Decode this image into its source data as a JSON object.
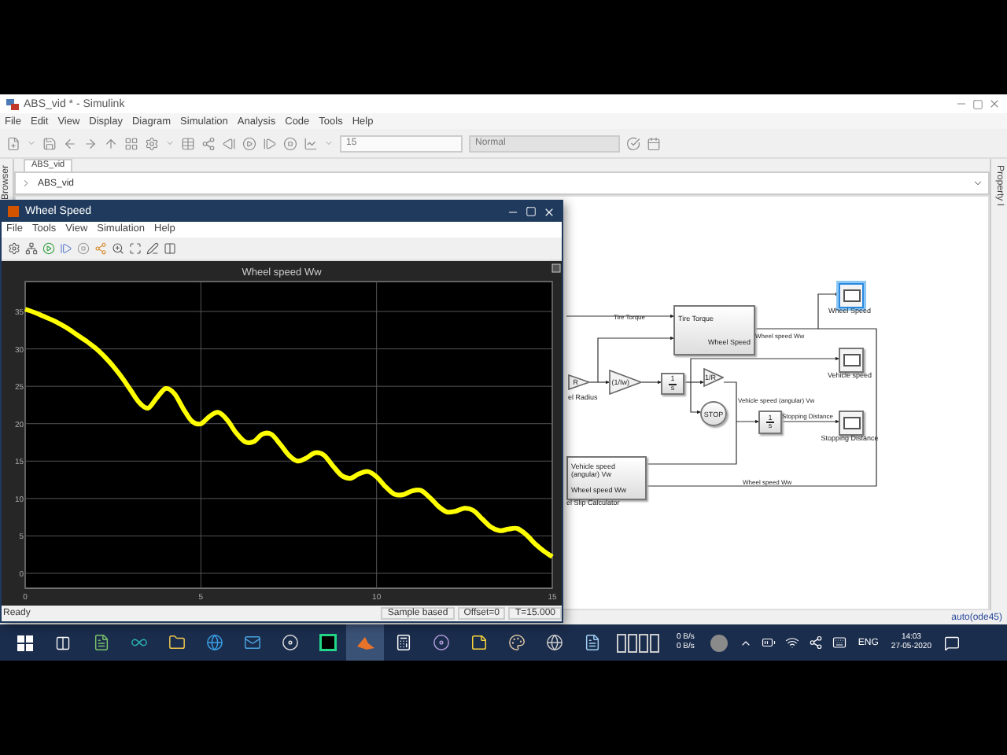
{
  "simulink_window": {
    "title": "ABS_vid * - Simulink",
    "menu": [
      "File",
      "Edit",
      "View",
      "Display",
      "Diagram",
      "Simulation",
      "Analysis",
      "Code",
      "Tools",
      "Help"
    ],
    "stop_time": "15",
    "sim_mode": "Normal",
    "tab": {
      "label": "ABS_vid",
      "selected": true
    },
    "breadcrumb": "ABS_vid",
    "left_panel": "Browser",
    "right_panel": "Property I",
    "status_right": "auto(ode45)"
  },
  "diagram": {
    "blocks": [
      {
        "kind": "scope",
        "label": "Wheel Speed",
        "selected": true
      },
      {
        "kind": "subsystem",
        "ports_in": [
          "Tire Torque"
        ],
        "ports_out": [
          "Wheel Speed"
        ]
      },
      {
        "kind": "scope",
        "label": "Vehicle speed",
        "selected": false
      },
      {
        "kind": "gain",
        "text": "R",
        "label": "el Radius"
      },
      {
        "kind": "gain",
        "text": "(1/Iw)"
      },
      {
        "kind": "integrator",
        "numerator": "1",
        "denominator": "s"
      },
      {
        "kind": "gain",
        "text": "1/R"
      },
      {
        "kind": "stop",
        "text": "STOP"
      },
      {
        "kind": "integrator",
        "numerator": "1",
        "denominator": "s"
      },
      {
        "kind": "scope",
        "label": "Stopping Distance",
        "selected": false
      },
      {
        "kind": "subsystem",
        "ports_in": [
          "Vehicle speed (angular) Vw",
          "Wheel speed Ww"
        ],
        "label": "el Slip Calculator"
      }
    ],
    "signal_labels": [
      "Tire Torque",
      "Wheel speed Ww",
      "Vehicle speed (angular) Vw",
      "Stopping Distance",
      "Wheel speed Ww"
    ]
  },
  "scope_window": {
    "title": "Wheel Speed",
    "menu": [
      "File",
      "Tools",
      "View",
      "Simulation",
      "Help"
    ],
    "chart_data": {
      "type": "line",
      "title": "Wheel speed Ww",
      "grid": true,
      "xlim": [
        0,
        15
      ],
      "ylim": [
        -2,
        39
      ],
      "xticks": [
        0,
        5,
        10,
        15
      ],
      "yticks": [
        0,
        5,
        10,
        15,
        20,
        25,
        30,
        35
      ],
      "x": [
        0,
        0.25,
        0.5,
        0.75,
        1,
        1.25,
        1.5,
        1.75,
        2,
        2.25,
        2.5,
        2.75,
        3,
        3.25,
        3.5,
        3.75,
        4,
        4.25,
        4.5,
        4.75,
        5,
        5.25,
        5.5,
        5.75,
        6,
        6.25,
        6.5,
        6.75,
        7,
        7.25,
        7.5,
        7.75,
        8,
        8.25,
        8.5,
        8.75,
        9,
        9.25,
        9.5,
        9.75,
        10,
        10.25,
        10.5,
        10.75,
        11,
        11.25,
        11.5,
        11.75,
        12,
        12.25,
        12.5,
        12.75,
        13,
        13.25,
        13.5,
        13.75,
        14,
        14.25,
        14.5,
        14.75,
        15
      ],
      "series": [
        {
          "color": "#ffff00",
          "values": [
            35.3,
            34.9,
            34.4,
            33.9,
            33.3,
            32.6,
            31.8,
            31.0,
            30.1,
            29.0,
            27.7,
            26.2,
            24.5,
            22.8,
            22.1,
            23.5,
            24.7,
            24.0,
            22.0,
            20.3,
            20.0,
            21.0,
            21.5,
            20.5,
            18.8,
            17.6,
            17.6,
            18.6,
            18.6,
            17.3,
            15.8,
            15.0,
            15.4,
            16.1,
            15.8,
            14.4,
            13.1,
            12.7,
            13.3,
            13.6,
            12.9,
            11.6,
            10.6,
            10.5,
            11.0,
            11.1,
            10.2,
            9.0,
            8.2,
            8.3,
            8.7,
            8.4,
            7.3,
            6.2,
            5.7,
            5.9,
            6.0,
            5.2,
            4.0,
            3.0,
            2.2
          ]
        }
      ]
    },
    "status": "Ready",
    "status_fields": [
      "Sample based",
      "Offset=0",
      "T=15.000"
    ]
  },
  "taskbar": {
    "network_up": "0 B/s",
    "network_down": "0 B/s",
    "language": "ENG",
    "time": "14:03",
    "date": "27-05-2020"
  }
}
